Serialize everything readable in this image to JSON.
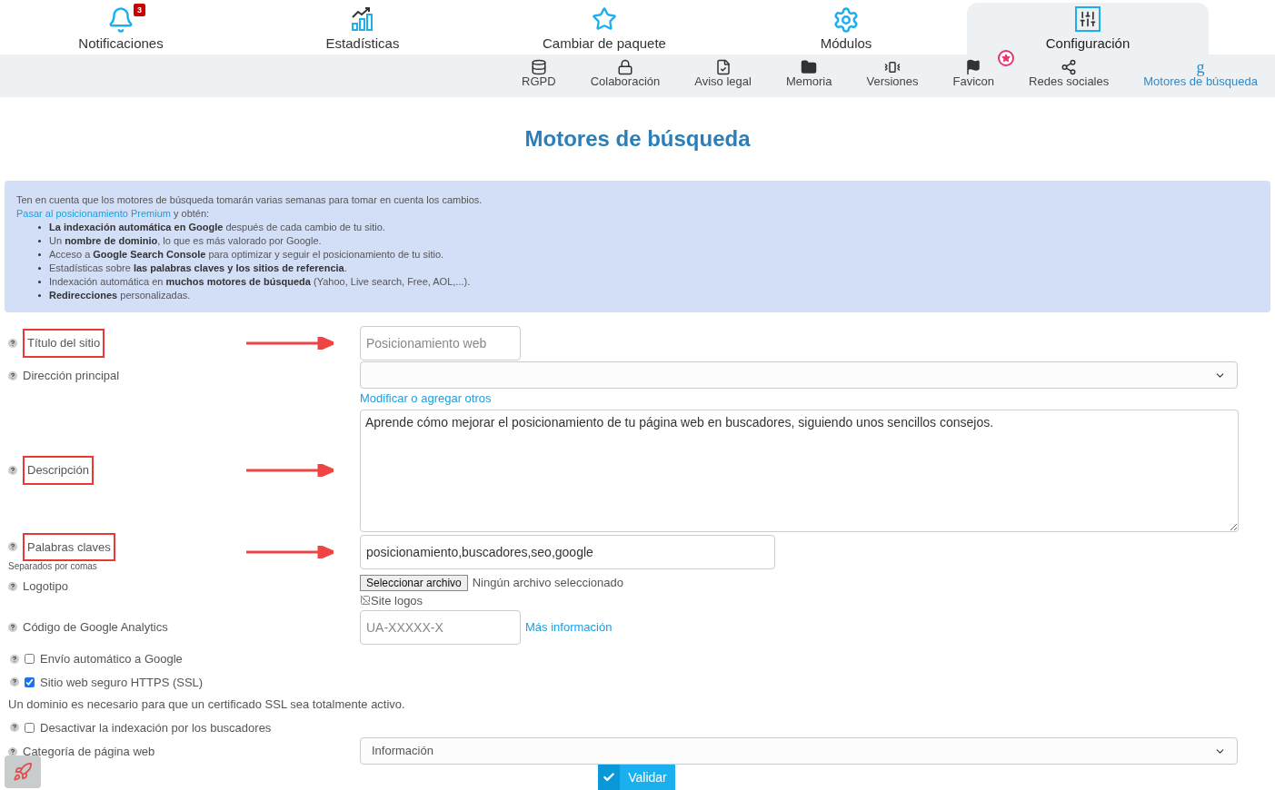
{
  "top_tabs": [
    {
      "label": "Notificaciones",
      "selected": false,
      "badge": "3"
    },
    {
      "label": "Estadísticas",
      "selected": false
    },
    {
      "label": "Cambiar de paquete",
      "selected": false
    },
    {
      "label": "Módulos",
      "selected": false
    },
    {
      "label": "Configuración",
      "selected": true
    }
  ],
  "sub_tabs": [
    {
      "label": "RGPD",
      "selected": false,
      "featured": false
    },
    {
      "label": "Colaboración",
      "selected": false,
      "featured": false
    },
    {
      "label": "Aviso legal",
      "selected": false,
      "featured": false
    },
    {
      "label": "Memoria",
      "selected": false,
      "featured": false
    },
    {
      "label": "Versiones",
      "selected": false,
      "featured": false
    },
    {
      "label": "Favicon",
      "selected": false,
      "featured": true
    },
    {
      "label": "Redes sociales",
      "selected": false,
      "featured": false
    },
    {
      "label": "Motores de búsqueda",
      "selected": true,
      "featured": false,
      "glyph": "g"
    }
  ],
  "page_title": "Motores de búsqueda",
  "notice": {
    "intro": "Ten en cuenta que los motores de búsqueda tomarán varias semanas para tomar en cuenta los cambios.",
    "link": "Pasar al posicionamiento Premium",
    "link_after": "y obtén:",
    "bullets": [
      "**La indexación automática en Google** después de cada cambio de tu sitio.",
      "Un **nombre de dominio**, lo que es más valorado por Google.",
      "Acceso a **Google Search Console** para optimizar y seguir el posicionamiento de tu sitio.",
      "Estadísticas sobre **las palabras claves y los sitios de referencia**.",
      "Indexación automática en **muchos motores de búsqueda** (Yahoo, Live search, Free, AOL,...).",
      "**Redirecciones** personalizadas."
    ]
  },
  "fields": [
    {
      "kind": "text",
      "label": "Título del sitio",
      "highlighted": true,
      "placeholder": "Posicionamiento web"
    },
    {
      "kind": "select",
      "label": "Dirección principal",
      "highlighted": false,
      "link": "Modificar o agregar otros"
    },
    {
      "kind": "textarea",
      "label": "Descripción",
      "highlighted": true,
      "value": "Aprende cómo mejorar el posicionamiento de tu página web en buscadores, siguiendo unos sencillos consejos."
    },
    {
      "kind": "text",
      "label": "Palabras claves",
      "hint": "Separados por comas",
      "highlighted": true,
      "value": "posicionamiento,buscadores,seo,google"
    },
    {
      "kind": "file",
      "label": "Logotipo",
      "highlighted": false,
      "button": "Seleccionar archivo",
      "status": "Ningún archivo seleccionado",
      "image_alt": "Site logos"
    },
    {
      "kind": "text",
      "label": "Código de Google Analytics",
      "highlighted": false,
      "placeholder": "UA-XXXXX-X",
      "link": "Más información"
    },
    {
      "kind": "checkbox",
      "label": "Envío automático a Google",
      "checked": false
    },
    {
      "kind": "checkbox",
      "label": "Sitio web seguro HTTPS (SSL)",
      "checked": true,
      "note": "Un dominio es necesario para que un certificado SSL sea totalmente activo."
    },
    {
      "kind": "checkbox",
      "label": "Desactivar la indexación por los buscadores",
      "checked": false
    },
    {
      "kind": "select",
      "label": "Categoría de página web",
      "highlighted": false,
      "value": "Información"
    }
  ],
  "submit": "Validar"
}
